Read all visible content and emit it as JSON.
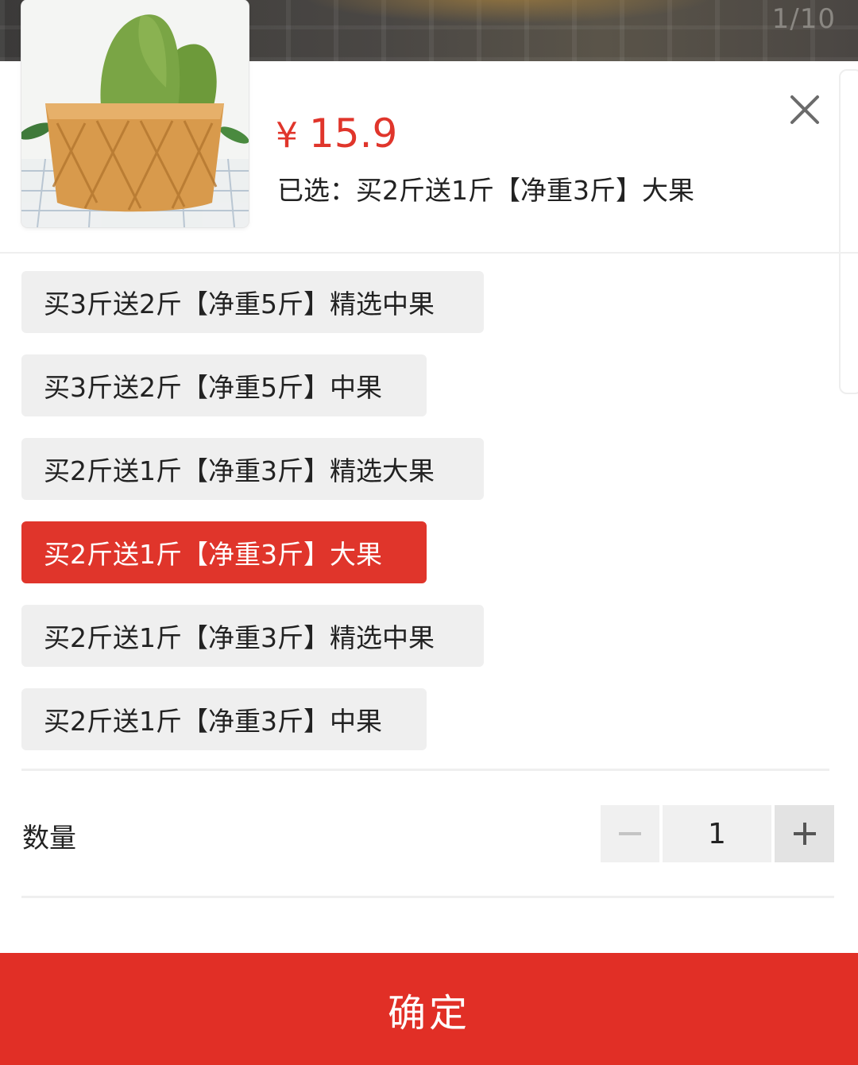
{
  "gallery": {
    "counter": "1/10"
  },
  "product": {
    "currency": "¥",
    "price": "15.9",
    "selected_text": "已选：买2斤送1斤【净重3斤】大果"
  },
  "options": [
    {
      "label": "买3斤送2斤【净重5斤】精选中果",
      "selected": false
    },
    {
      "label": "买3斤送2斤【净重5斤】中果",
      "selected": false
    },
    {
      "label": "买2斤送1斤【净重3斤】精选大果",
      "selected": false
    },
    {
      "label": "买2斤送1斤【净重3斤】大果",
      "selected": true
    },
    {
      "label": "买2斤送1斤【净重3斤】精选中果",
      "selected": false
    },
    {
      "label": "买2斤送1斤【净重3斤】中果",
      "selected": false
    }
  ],
  "quantity": {
    "label": "数量",
    "value": "1"
  },
  "confirm_label": "确定",
  "colors": {
    "accent": "#e0352b",
    "chip_bg": "#efefef"
  },
  "icons": {
    "close": "close-icon",
    "minus": "minus-icon",
    "plus": "plus-icon"
  }
}
